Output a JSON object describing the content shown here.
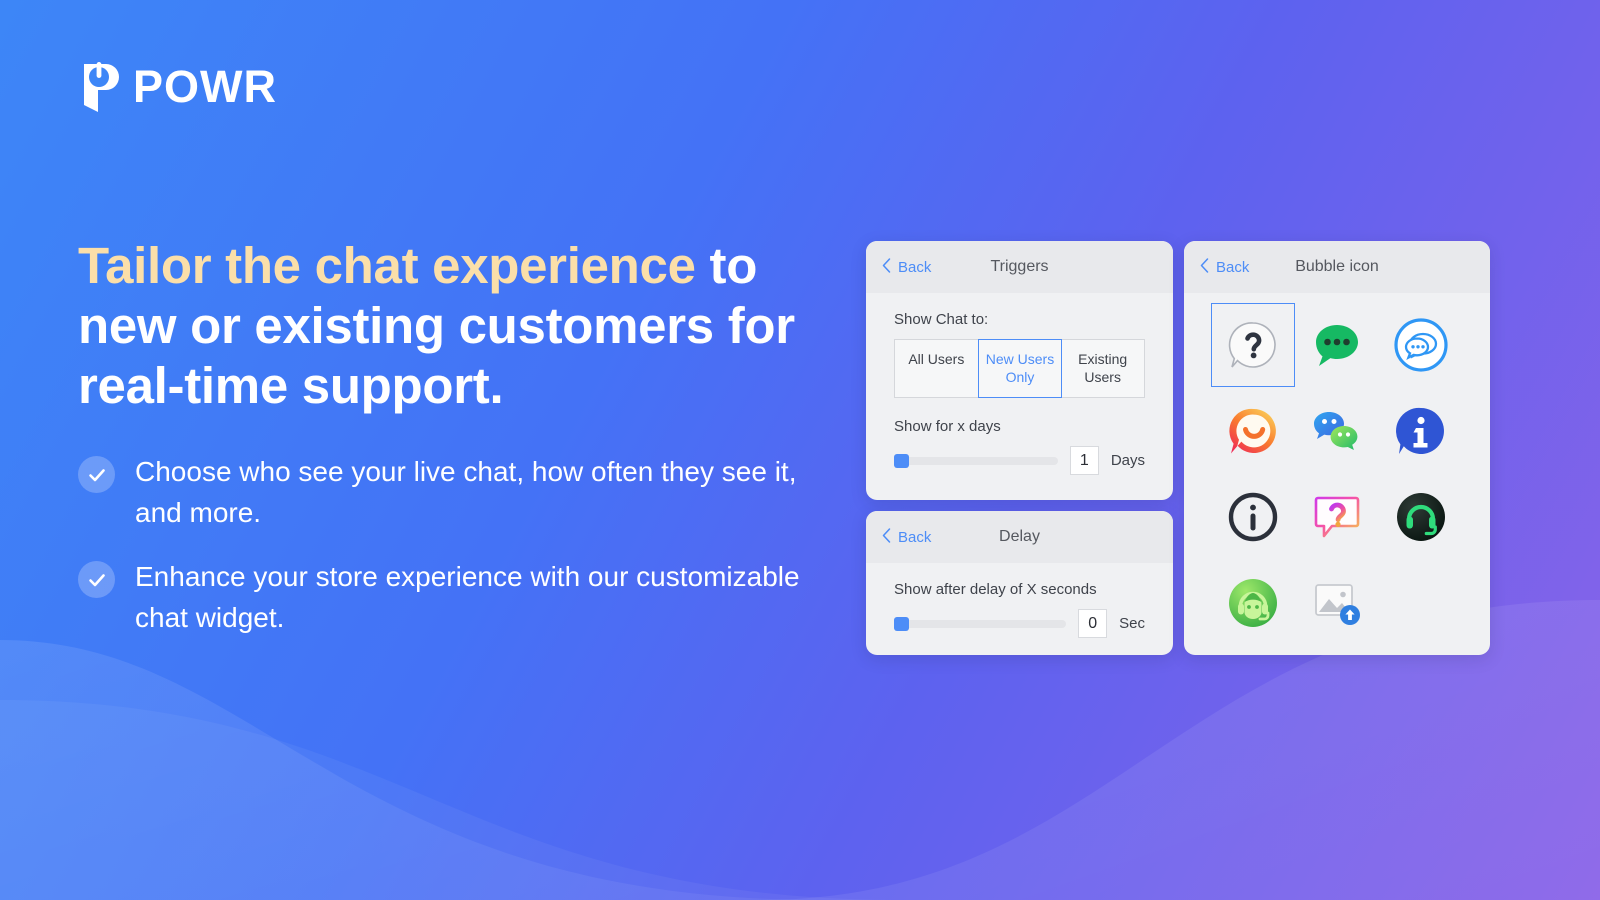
{
  "brand": {
    "name": "POWR",
    "logo_icon": "powr-logo-icon"
  },
  "hero": {
    "headline_accent": "Tailor the chat experience",
    "headline_rest": " to new or existing customers for real-time support.",
    "accent_color": "#fbdfa9",
    "bullets": [
      {
        "icon": "check-circle-icon",
        "text": "Choose who see your live chat, how often they see it, and more."
      },
      {
        "icon": "check-circle-icon",
        "text": "Enhance your store experience with our customizable chat widget."
      }
    ]
  },
  "panels": {
    "triggers": {
      "back_label": "Back",
      "back_icon": "chevron-left-icon",
      "title": "Triggers",
      "show_chat_label": "Show Chat to:",
      "segments": [
        {
          "label": "All Users",
          "selected": false
        },
        {
          "label": "New Users Only",
          "selected": true
        },
        {
          "label": "Existing Users",
          "selected": false
        }
      ],
      "days_label": "Show for x days",
      "days_value": "1",
      "days_unit": "Days",
      "days_slider_percent": 0
    },
    "delay": {
      "back_label": "Back",
      "back_icon": "chevron-left-icon",
      "title": "Delay",
      "delay_label": "Show after delay of X seconds",
      "delay_value": "0",
      "delay_unit": "Sec",
      "delay_slider_percent": 0
    },
    "bubble_icon": {
      "back_label": "Back",
      "back_icon": "chevron-left-icon",
      "title": "Bubble icon",
      "icons": [
        {
          "name": "question-bubble-outline-icon",
          "selected": true
        },
        {
          "name": "green-chat-bubble-icon",
          "selected": false
        },
        {
          "name": "blue-ring-double-bubble-icon",
          "selected": false
        },
        {
          "name": "orange-smiley-bubble-icon",
          "selected": false
        },
        {
          "name": "wechat-double-bubble-icon",
          "selected": false
        },
        {
          "name": "blue-info-bubble-icon",
          "selected": false
        },
        {
          "name": "dark-info-circle-icon",
          "selected": false
        },
        {
          "name": "pink-question-bubble-icon",
          "selected": false
        },
        {
          "name": "dark-headset-circle-icon",
          "selected": false
        },
        {
          "name": "green-agent-headset-icon",
          "selected": false
        },
        {
          "name": "image-upload-placeholder-icon",
          "selected": false
        }
      ]
    }
  },
  "theme": {
    "bg_start": "#3d86f7",
    "bg_end": "#8a63e8",
    "accent_blue": "#4d8df7",
    "panel_bg": "#f0f1f3",
    "panel_header_bg": "#e8e9ec"
  }
}
